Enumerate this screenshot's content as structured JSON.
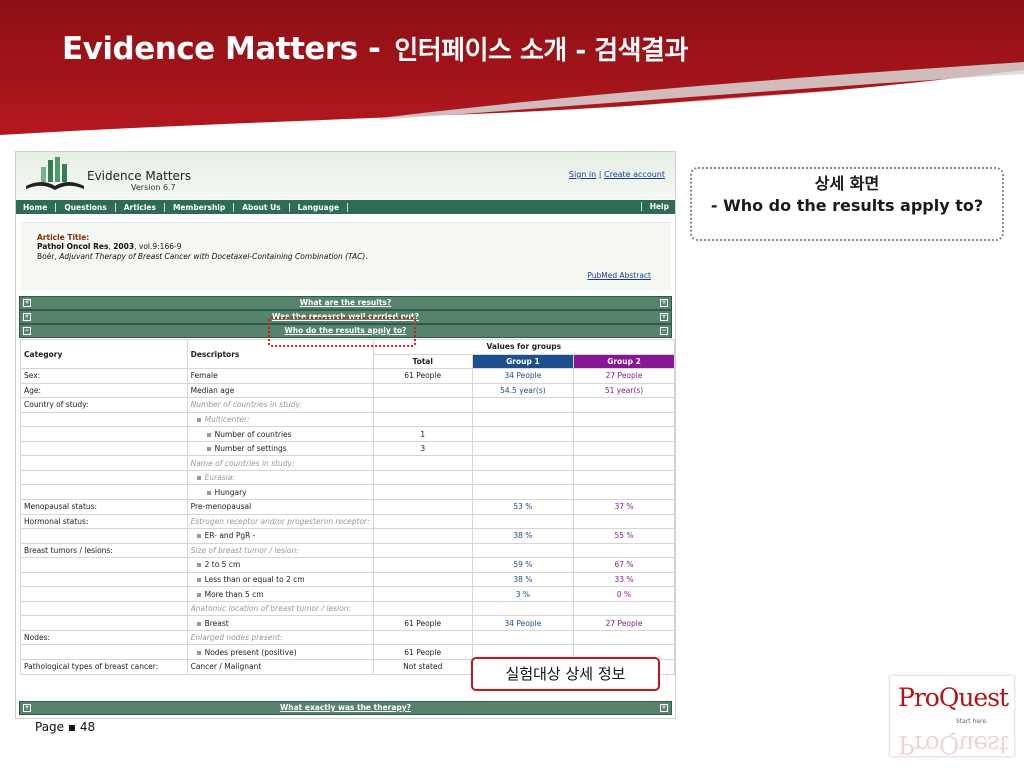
{
  "slide": {
    "title_en": "Evidence Matters -",
    "title_ko": "인터페이스 소개 - 검색결과",
    "page_label": "Page",
    "page_number": "48"
  },
  "site": {
    "logo_text": "Evidence Matters",
    "version": "Version 6.7",
    "sign_in": "Sign in",
    "separator": "|",
    "create_account": "Create account",
    "nav": [
      "Home",
      "Questions",
      "Articles",
      "Membership",
      "About Us",
      "Language"
    ],
    "help": "Help"
  },
  "article": {
    "label": "Article Title:",
    "source": "Pathol Oncol Res",
    "year": "2003",
    "volume": "vol.9:166-9",
    "author": "Boér",
    "title": "Adjuvant Therapy of Breast Cancer with Docetaxel-Containing Combination (TAC)",
    "pubmed": "PubMed Abstract"
  },
  "sections": {
    "results": "What are the results?",
    "research": "Was the research well carried out?",
    "apply": "Who do the results apply to?",
    "therapy": "What exactly was the therapy?"
  },
  "table": {
    "col_category": "Category",
    "col_descriptors": "Descriptors",
    "values_for_groups": "Values for groups",
    "col_total": "Total",
    "col_group1": "Group 1",
    "col_group2": "Group 2",
    "rows": [
      {
        "category": "Sex:",
        "desc": "Female",
        "style": "plain",
        "total": "61 People",
        "g1": "34 People",
        "g2": "27 People"
      },
      {
        "category": "Age:",
        "desc": "Median age",
        "style": "plain",
        "total": "",
        "g1": "54.5 year(s)",
        "g2": "51 year(s)"
      },
      {
        "category": "Country of study:",
        "desc": "Number of countries in study:",
        "style": "ital",
        "total": "",
        "g1": "",
        "g2": ""
      },
      {
        "category": "",
        "desc": "Multicenter:",
        "style": "ital1",
        "total": "",
        "g1": "",
        "g2": ""
      },
      {
        "category": "",
        "desc": "Number of countries",
        "style": "b2",
        "total": "1",
        "g1": "",
        "g2": ""
      },
      {
        "category": "",
        "desc": "Number of settings",
        "style": "b2",
        "total": "3",
        "g1": "",
        "g2": ""
      },
      {
        "category": "",
        "desc": "Name of countries in study:",
        "style": "ital",
        "total": "",
        "g1": "",
        "g2": ""
      },
      {
        "category": "",
        "desc": "Eurasia:",
        "style": "ital1",
        "total": "",
        "g1": "",
        "g2": ""
      },
      {
        "category": "",
        "desc": "Hungary",
        "style": "b2",
        "total": "",
        "g1": "",
        "g2": ""
      },
      {
        "category": "Menopausal status:",
        "desc": "Pre-menopausal",
        "style": "plain",
        "total": "",
        "g1": "53 %",
        "g2": "37 %"
      },
      {
        "category": "Hormonal status:",
        "desc": "Estrogen receptor and/or progesteron receptor:",
        "style": "ital2",
        "total": "",
        "g1": "",
        "g2": ""
      },
      {
        "category": "",
        "desc": "ER- and PgR -",
        "style": "b1",
        "total": "",
        "g1": "38 %",
        "g2": "55 %"
      },
      {
        "category": "Breast tumors / lesions:",
        "desc": "Size of breast tumor / lesion:",
        "style": "ital",
        "total": "",
        "g1": "",
        "g2": ""
      },
      {
        "category": "",
        "desc": "2 to 5 cm",
        "style": "b1",
        "total": "",
        "g1": "59 %",
        "g2": "67 %"
      },
      {
        "category": "",
        "desc": "Less than or equal to 2 cm",
        "style": "b1",
        "total": "",
        "g1": "38 %",
        "g2": "33 %"
      },
      {
        "category": "",
        "desc": "More than 5 cm",
        "style": "b1",
        "total": "",
        "g1": "3 %",
        "g2": "0 %"
      },
      {
        "category": "",
        "desc": "Anatomic location of breast tumor / lesion:",
        "style": "ital2",
        "total": "",
        "g1": "",
        "g2": ""
      },
      {
        "category": "",
        "desc": "Breast",
        "style": "b1",
        "total": "61 People",
        "g1": "34 People",
        "g2": "27 People"
      },
      {
        "category": "Nodes:",
        "desc": "Enlarged nodes present:",
        "style": "ital",
        "total": "",
        "g1": "",
        "g2": ""
      },
      {
        "category": "",
        "desc": "Nodes present (positive)",
        "style": "b1",
        "total": "61 People",
        "g1": "",
        "g2": ""
      },
      {
        "category": "Pathological types of breast cancer:",
        "desc": "Cancer / Malignant",
        "style": "plain",
        "total": "Not stated",
        "g1": "",
        "g2": ""
      }
    ]
  },
  "callout": {
    "line1": "상세 화면",
    "line2": "- Who do the results apply to?"
  },
  "annotation": "실험대상 상세 정보",
  "proquest": {
    "brand": "ProQuest",
    "tagline": "Start here."
  },
  "colors": {
    "header_red": "#9e1318",
    "nav_green": "#2f6c55",
    "group1": "#1b4f90",
    "group2": "#8a1696"
  }
}
